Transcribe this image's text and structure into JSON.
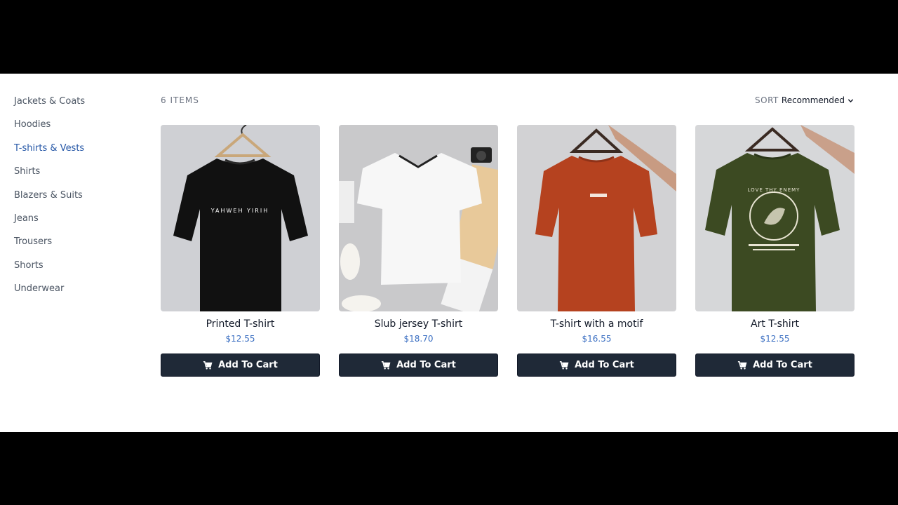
{
  "sidebar": {
    "items": [
      {
        "label": "Jackets & Coats",
        "active": false
      },
      {
        "label": "Hoodies",
        "active": false
      },
      {
        "label": "T-shirts & Vests",
        "active": true
      },
      {
        "label": "Shirts",
        "active": false
      },
      {
        "label": "Blazers & Suits",
        "active": false
      },
      {
        "label": "Jeans",
        "active": false
      },
      {
        "label": "Trousers",
        "active": false
      },
      {
        "label": "Shorts",
        "active": false
      },
      {
        "label": "Underwear",
        "active": false
      }
    ]
  },
  "listing": {
    "count_label": "6 ITEMS",
    "sort_label": "SORT",
    "sort_value": "Recommended"
  },
  "products": [
    {
      "name": "Printed T-shirt",
      "price": "$12.55",
      "button": "Add To Cart",
      "shirt_color": "#111111",
      "bg": "#cfd0d4",
      "print": "YAHWEH YIRIH",
      "print_color": "#ffffff"
    },
    {
      "name": "Slub jersey T-shirt",
      "price": "$18.70",
      "button": "Add To Cart",
      "shirt_color": "#f7f7f7",
      "bg": "#c9c9cb",
      "print": "",
      "print_color": "#ffffff"
    },
    {
      "name": "T-shirt with a motif",
      "price": "$16.55",
      "button": "Add To Cart",
      "shirt_color": "#b5421f",
      "bg": "#d2d2d4",
      "print": "",
      "print_color": "#ffffff"
    },
    {
      "name": "Art T-shirt",
      "price": "$12.55",
      "button": "Add To Cart",
      "shirt_color": "#3c4a22",
      "bg": "#d6d7d9",
      "print": "LOVE THY ENEMY",
      "print_color": "#e8e4d2"
    }
  ],
  "colors": {
    "accent": "#2456a6",
    "price": "#3b6fc2",
    "button_bg": "#1f2937"
  },
  "icons": {
    "cart": "shopping-cart-icon",
    "sort": "chevron-down-icon"
  }
}
